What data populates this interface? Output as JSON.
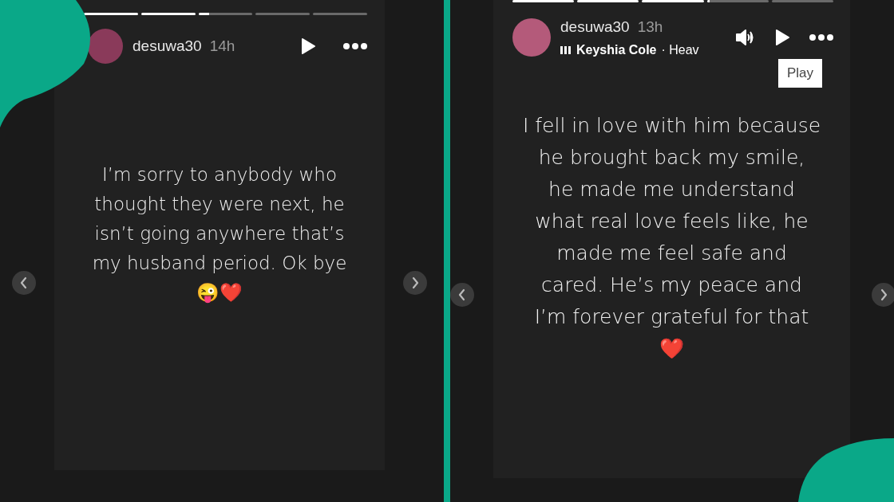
{
  "stories": [
    {
      "username": "desuwa30",
      "time": "14h",
      "progress": [
        {
          "level": 1
        },
        {
          "level": 1
        },
        {
          "level": 0.2
        },
        {
          "level": 0
        },
        {
          "level": 0
        }
      ],
      "controls": [
        {
          "kind": "play"
        },
        {
          "kind": "more"
        }
      ],
      "lines": [
        "I’m sorry to anybody who",
        "thought they were next, he",
        "isn’t going anywhere that’s",
        "my husband period. Ok bye",
        "😜❤️"
      ]
    },
    {
      "username": "desuwa30",
      "time": "13h",
      "music": {
        "artist": "Keyshia Cole",
        "track": "· Heav"
      },
      "progress": [
        {
          "level": 1
        },
        {
          "level": 1
        },
        {
          "level": 1
        },
        {
          "level": 0.05
        },
        {
          "level": 0
        }
      ],
      "controls": [
        {
          "kind": "sound"
        },
        {
          "kind": "play"
        },
        {
          "kind": "more"
        }
      ],
      "tooltip": "Play",
      "lines": [
        "I fell in love with him because",
        "he brought back my smile,",
        "he made me understand",
        "what real love feels like, he",
        "made me feel safe and",
        "cared. He’s my peace and",
        "I’m forever grateful for that",
        "❤️"
      ]
    }
  ]
}
